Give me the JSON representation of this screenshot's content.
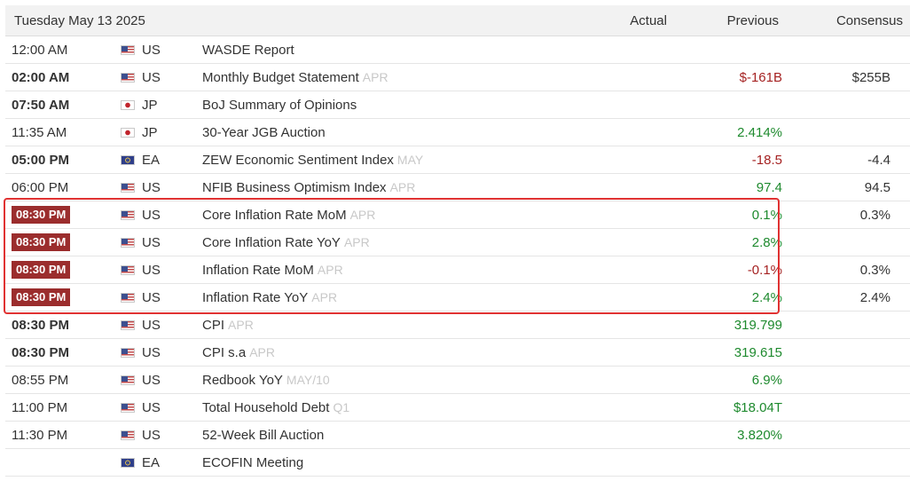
{
  "header": {
    "date": "Tuesday May 13 2025",
    "actual": "Actual",
    "previous": "Previous",
    "consensus": "Consensus"
  },
  "colors": {
    "highlight_badge": "#9b2d2d",
    "highlight_border": "#e03232",
    "positive": "#1e8a2e",
    "negative": "#a52222"
  },
  "rows": [
    {
      "time": "12:00 AM",
      "time_style": "normal",
      "flag": "us-flag-icon",
      "country": "US",
      "event": "WASDE Report",
      "period": "",
      "actual": "",
      "previous": "",
      "previous_tone": "",
      "consensus": ""
    },
    {
      "time": "02:00 AM",
      "time_style": "bold",
      "flag": "us-flag-icon",
      "country": "US",
      "event": "Monthly Budget Statement",
      "period": "APR",
      "actual": "",
      "previous": "$-161B",
      "previous_tone": "neg",
      "consensus": "$255B"
    },
    {
      "time": "07:50 AM",
      "time_style": "bold",
      "flag": "jp-flag-icon",
      "country": "JP",
      "event": "BoJ Summary of Opinions",
      "period": "",
      "actual": "",
      "previous": "",
      "previous_tone": "",
      "consensus": ""
    },
    {
      "time": "11:35 AM",
      "time_style": "normal",
      "flag": "jp-flag-icon",
      "country": "JP",
      "event": "30-Year JGB Auction",
      "period": "",
      "actual": "",
      "previous": "2.414%",
      "previous_tone": "pos",
      "consensus": ""
    },
    {
      "time": "05:00 PM",
      "time_style": "bold",
      "flag": "eu-flag-icon",
      "country": "EA",
      "event": "ZEW Economic Sentiment Index",
      "period": "MAY",
      "actual": "",
      "previous": "-18.5",
      "previous_tone": "neg",
      "consensus": "-4.4"
    },
    {
      "time": "06:00 PM",
      "time_style": "normal",
      "flag": "us-flag-icon",
      "country": "US",
      "event": "NFIB Business Optimism Index",
      "period": "APR",
      "actual": "",
      "previous": "97.4",
      "previous_tone": "pos",
      "consensus": "94.5"
    },
    {
      "time": "08:30 PM",
      "time_style": "badge",
      "flag": "us-flag-icon",
      "country": "US",
      "event": "Core Inflation Rate MoM",
      "period": "APR",
      "actual": "",
      "previous": "0.1%",
      "previous_tone": "pos",
      "consensus": "0.3%"
    },
    {
      "time": "08:30 PM",
      "time_style": "badge",
      "flag": "us-flag-icon",
      "country": "US",
      "event": "Core Inflation Rate YoY",
      "period": "APR",
      "actual": "",
      "previous": "2.8%",
      "previous_tone": "pos",
      "consensus": ""
    },
    {
      "time": "08:30 PM",
      "time_style": "badge",
      "flag": "us-flag-icon",
      "country": "US",
      "event": "Inflation Rate MoM",
      "period": "APR",
      "actual": "",
      "previous": "-0.1%",
      "previous_tone": "neg",
      "consensus": "0.3%"
    },
    {
      "time": "08:30 PM",
      "time_style": "badge",
      "flag": "us-flag-icon",
      "country": "US",
      "event": "Inflation Rate YoY",
      "period": "APR",
      "actual": "",
      "previous": "2.4%",
      "previous_tone": "pos",
      "consensus": "2.4%"
    },
    {
      "time": "08:30 PM",
      "time_style": "bold",
      "flag": "us-flag-icon",
      "country": "US",
      "event": "CPI",
      "period": "APR",
      "actual": "",
      "previous": "319.799",
      "previous_tone": "pos",
      "consensus": ""
    },
    {
      "time": "08:30 PM",
      "time_style": "bold",
      "flag": "us-flag-icon",
      "country": "US",
      "event": "CPI s.a",
      "period": "APR",
      "actual": "",
      "previous": "319.615",
      "previous_tone": "pos",
      "consensus": ""
    },
    {
      "time": "08:55 PM",
      "time_style": "normal",
      "flag": "us-flag-icon",
      "country": "US",
      "event": "Redbook YoY",
      "period": "MAY/10",
      "actual": "",
      "previous": "6.9%",
      "previous_tone": "pos",
      "consensus": ""
    },
    {
      "time": "11:00 PM",
      "time_style": "normal",
      "flag": "us-flag-icon",
      "country": "US",
      "event": "Total Household Debt",
      "period": "Q1",
      "actual": "",
      "previous": "$18.04T",
      "previous_tone": "pos",
      "consensus": ""
    },
    {
      "time": "11:30 PM",
      "time_style": "normal",
      "flag": "us-flag-icon",
      "country": "US",
      "event": "52-Week Bill Auction",
      "period": "",
      "actual": "",
      "previous": "3.820%",
      "previous_tone": "pos",
      "consensus": ""
    },
    {
      "time": "",
      "time_style": "normal",
      "flag": "eu-flag-icon",
      "country": "EA",
      "event": "ECOFIN Meeting",
      "period": "",
      "actual": "",
      "previous": "",
      "previous_tone": "",
      "consensus": ""
    }
  ]
}
